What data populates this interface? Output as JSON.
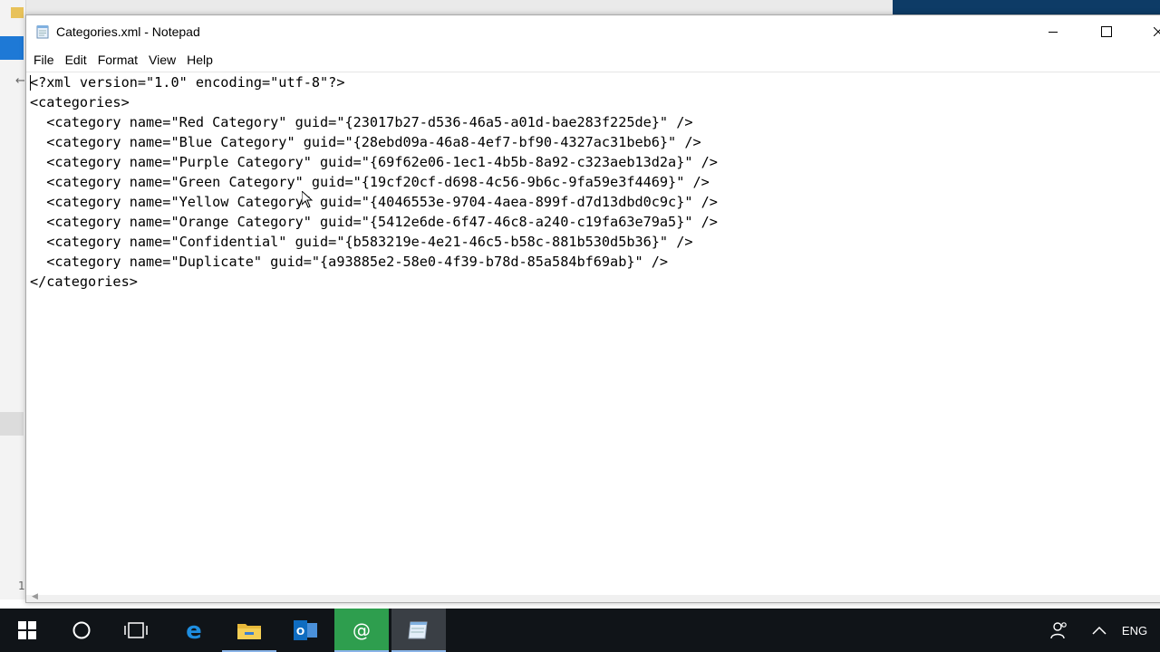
{
  "window": {
    "title": "Categories.xml - Notepad",
    "app_icon": "notepad-icon"
  },
  "menu": [
    "File",
    "Edit",
    "Format",
    "View",
    "Help"
  ],
  "editor": {
    "lines": [
      "<?xml version=\"1.0\" encoding=\"utf-8\"?>",
      "<categories>",
      "  <category name=\"Red Category\" guid=\"{23017b27-d536-46a5-a01d-bae283f225de}\" />",
      "  <category name=\"Blue Category\" guid=\"{28ebd09a-46a8-4ef7-bf90-4327ac31beb6}\" />",
      "  <category name=\"Purple Category\" guid=\"{69f62e06-1ec1-4b5b-8a92-c323aeb13d2a}\" />",
      "  <category name=\"Green Category\" guid=\"{19cf20cf-d698-4c56-9b6c-9fa59e3f4469}\" />",
      "  <category name=\"Yellow Category\" guid=\"{4046553e-9704-4aea-899f-d7d13dbd0c9c}\" />",
      "  <category name=\"Orange Category\" guid=\"{5412e6de-6f47-46c8-a240-c19fa63e79a5}\" />",
      "  <category name=\"Confidential\" guid=\"{b583219e-4e21-46c5-b58c-881b530d5b36}\" />",
      "  <category name=\"Duplicate\" guid=\"{a93885e2-58e0-4f39-b78d-85a584bf69ab}\" />",
      "</categories>"
    ]
  },
  "background": {
    "left_number": "1"
  },
  "taskbar": {
    "apps": [
      {
        "name": "start-button",
        "icon": "windows-logo-icon"
      },
      {
        "name": "search-button",
        "icon": "cortana-circle-icon"
      },
      {
        "name": "task-view-button",
        "icon": "task-view-icon"
      },
      {
        "name": "taskbar-edge",
        "icon": "edge-icon"
      },
      {
        "name": "taskbar-file-explorer",
        "icon": "folder-icon"
      },
      {
        "name": "taskbar-outlook",
        "icon": "outlook-icon"
      },
      {
        "name": "taskbar-mail-app",
        "icon": "at-sign-icon"
      },
      {
        "name": "taskbar-notepad",
        "icon": "notepad-icon"
      }
    ],
    "tray": {
      "people_icon": "people-icon",
      "chevron_icon": "chevron-up-icon",
      "language": "ENG"
    }
  },
  "colors": {
    "taskbar_bg": "#101418",
    "accent_blue": "#1e79d6",
    "mail_green": "#2e9e4e"
  }
}
